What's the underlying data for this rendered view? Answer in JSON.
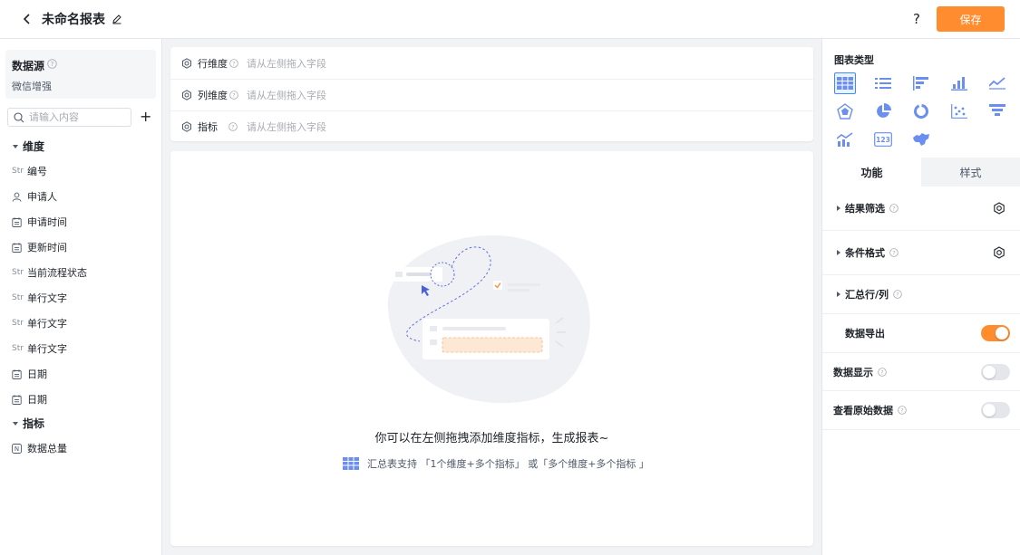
{
  "header": {
    "title": "未命名报表",
    "help_label": "?",
    "save_label": "保存"
  },
  "left": {
    "datasource_title": "数据源",
    "datasource_name": "微信增强",
    "search_placeholder": "请输入内容",
    "add_label": "+",
    "dimension_group": "维度",
    "dimensions": [
      {
        "type": "str",
        "type_label": "Str",
        "name": "编号"
      },
      {
        "type": "user",
        "name": "申请人"
      },
      {
        "type": "date",
        "name": "申请时间"
      },
      {
        "type": "date",
        "name": "更新时间"
      },
      {
        "type": "str",
        "type_label": "Str",
        "name": "当前流程状态"
      },
      {
        "type": "str",
        "type_label": "Str",
        "name": "单行文字"
      },
      {
        "type": "str",
        "type_label": "Str",
        "name": "单行文字"
      },
      {
        "type": "str",
        "type_label": "Str",
        "name": "单行文字"
      },
      {
        "type": "date",
        "name": "日期"
      },
      {
        "type": "date",
        "name": "日期"
      }
    ],
    "metric_group": "指标",
    "metrics": [
      {
        "type": "number",
        "name": "数据总量"
      }
    ]
  },
  "center": {
    "rows": [
      {
        "label": "行维度",
        "placeholder": "请从左侧拖入字段"
      },
      {
        "label": "列维度",
        "placeholder": "请从左侧拖入字段"
      },
      {
        "label": "指标",
        "placeholder": "请从左侧拖入字段"
      }
    ],
    "empty_title": "你可以在左侧拖拽添加维度指标，生成报表~",
    "empty_sub": "汇总表支持 「1个维度+多个指标」 或「多个维度+多个指标 」"
  },
  "right": {
    "chart_type_title": "图表类型",
    "tabs": [
      "功能",
      "样式"
    ],
    "options": [
      {
        "label": "结果筛选"
      },
      {
        "label": "条件格式"
      },
      {
        "label": "汇总行/列"
      }
    ],
    "toggles": [
      {
        "label": "数据导出",
        "on": true
      },
      {
        "label": "数据显示",
        "on": false
      },
      {
        "label": "查看原始数据",
        "on": false
      }
    ]
  },
  "colors": {
    "accent": "#ff8c2f",
    "chart_icon": "#6b8ff0",
    "active_border": "#3a8dff"
  },
  "icons": {
    "chart_types": [
      "table-chart-icon",
      "list-chart-icon",
      "bar-horizontal-icon",
      "bar-vertical-icon",
      "line-chart-icon",
      "radar-chart-icon",
      "pie-chart-icon",
      "donut-chart-icon",
      "scatter-chart-icon",
      "funnel-chart-icon",
      "combo-chart-icon",
      "number-card-icon",
      "map-chart-icon"
    ]
  }
}
